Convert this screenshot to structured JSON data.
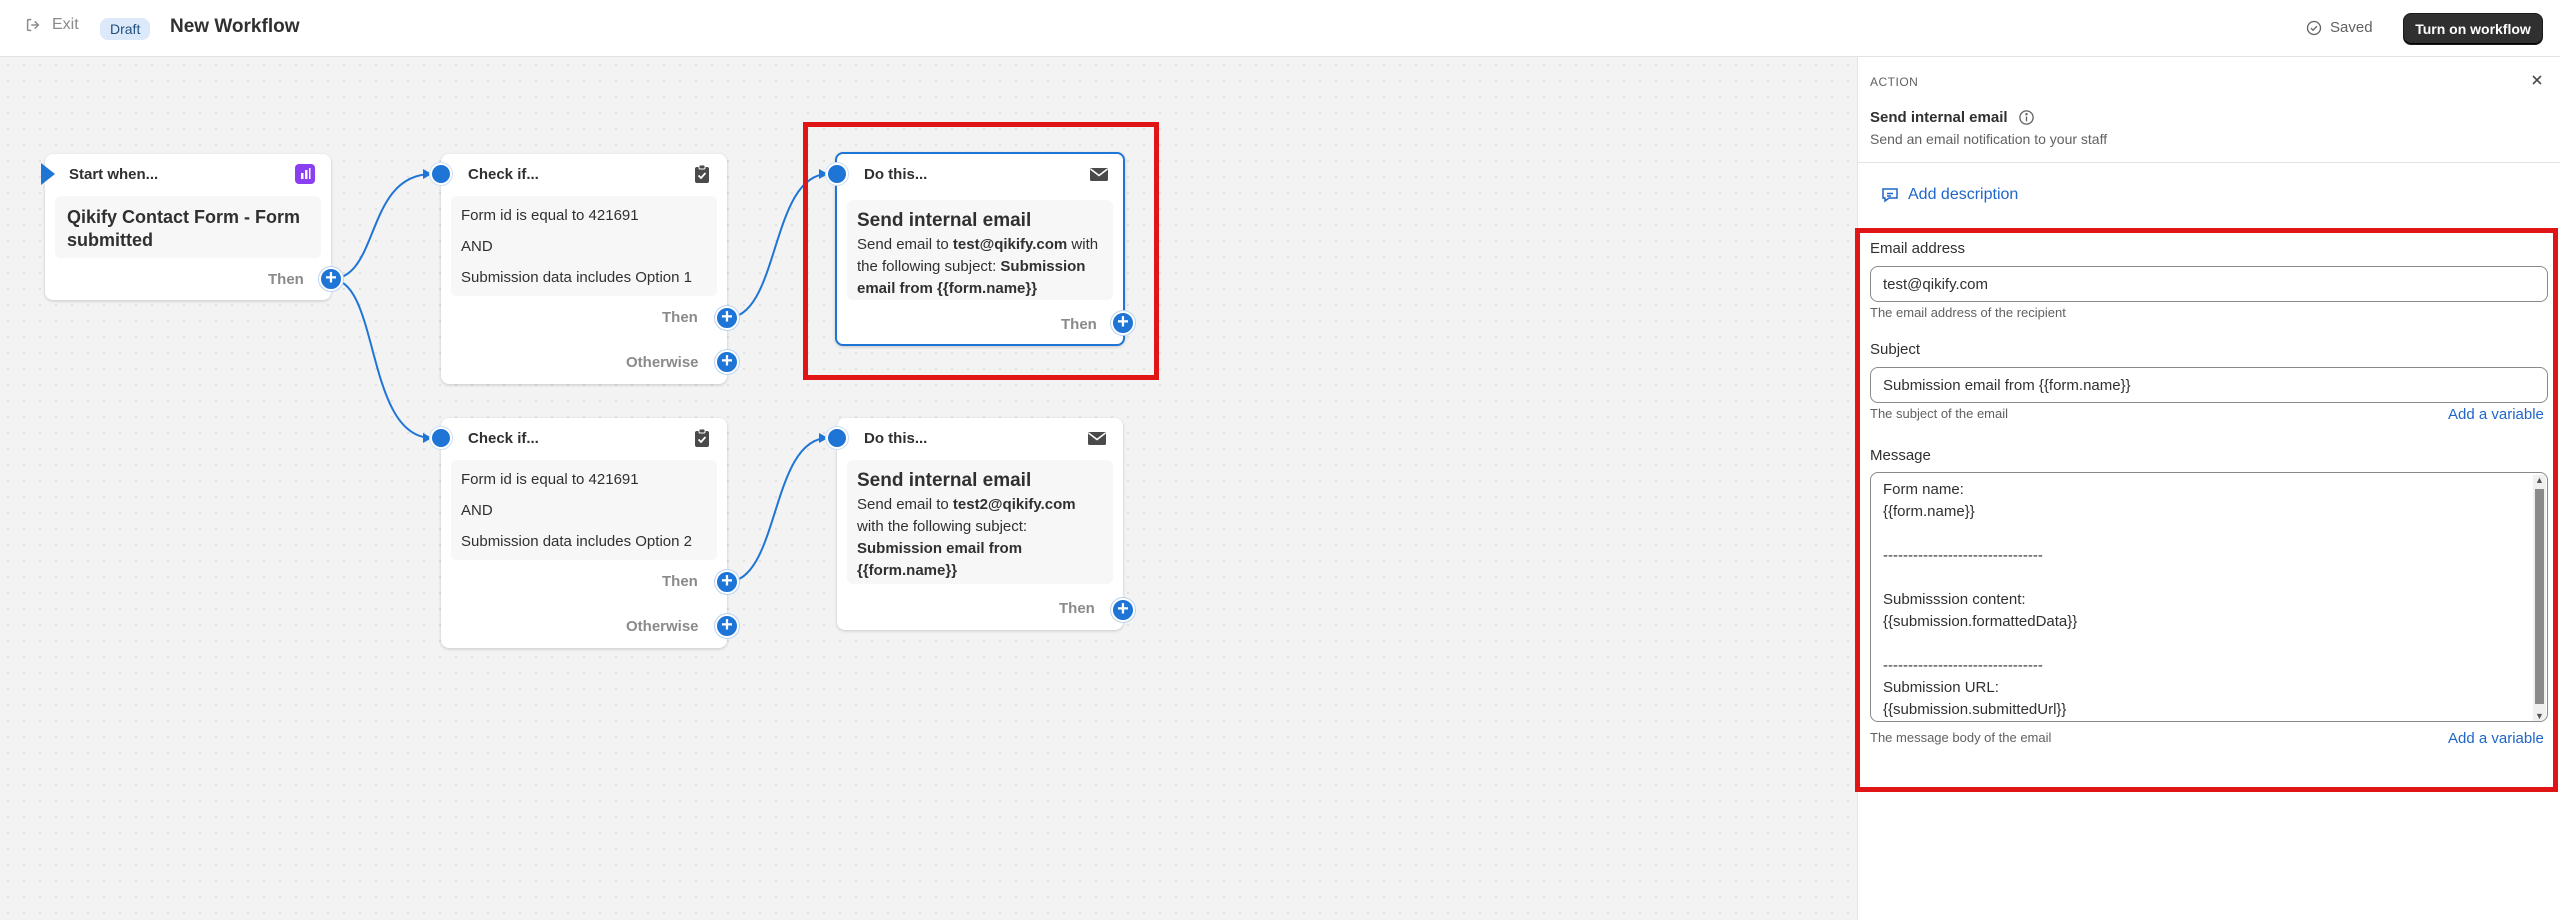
{
  "topbar": {
    "exit_label": "Exit",
    "status_badge": "Draft",
    "title": "New Workflow",
    "saved_label": "Saved",
    "turn_on_label": "Turn on workflow"
  },
  "nodes": {
    "trigger": {
      "head": "Start when...",
      "title": "Qikify Contact Form - Form submitted",
      "then_label": "Then"
    },
    "condition1": {
      "head": "Check if...",
      "lines": [
        "Form id is equal to 421691",
        "AND",
        "Submission data includes Option 1"
      ],
      "then_label": "Then",
      "otherwise_label": "Otherwise"
    },
    "condition2": {
      "head": "Check if...",
      "lines": [
        "Form id is equal to 421691",
        "AND",
        "Submission data includes Option 2"
      ],
      "then_label": "Then",
      "otherwise_label": "Otherwise"
    },
    "action1": {
      "head": "Do this...",
      "title": "Send internal email",
      "desc_prefix": "Send email to ",
      "desc_email": "test@qikify.com",
      "desc_middle": " with the following subject: ",
      "desc_subject": "Submission email from {{form.name}}",
      "then_label": "Then"
    },
    "action2": {
      "head": "Do this...",
      "title": "Send internal email",
      "desc_prefix": "Send email to ",
      "desc_email": "test2@qikify.com",
      "desc_middle": " with the following subject: ",
      "desc_subject": "Submission email from {{form.name}}",
      "then_label": "Then"
    }
  },
  "panel": {
    "section_label": "ACTION",
    "title": "Send internal email",
    "subtitle": "Send an email notification to your staff",
    "add_description_label": "Add description",
    "email": {
      "label": "Email address",
      "value": "test@qikify.com",
      "help": "The email address of the recipient"
    },
    "subject": {
      "label": "Subject",
      "value": "Submission email from {{form.name}}",
      "help": "The subject of the email",
      "add_variable": "Add a variable"
    },
    "message": {
      "label": "Message",
      "value": "Form name:\n{{form.name}}\n\n--------------------------------\n\nSubmisssion content:\n{{submission.formattedData}}\n\n--------------------------------\nSubmission URL:\n{{submission.submittedUrl}}",
      "help": "The message body of the email",
      "add_variable": "Add a variable"
    }
  },
  "colors": {
    "accent": "#1f75d6",
    "link": "#1f66c9",
    "highlight": "#e01515",
    "primary_button": "#303030"
  }
}
